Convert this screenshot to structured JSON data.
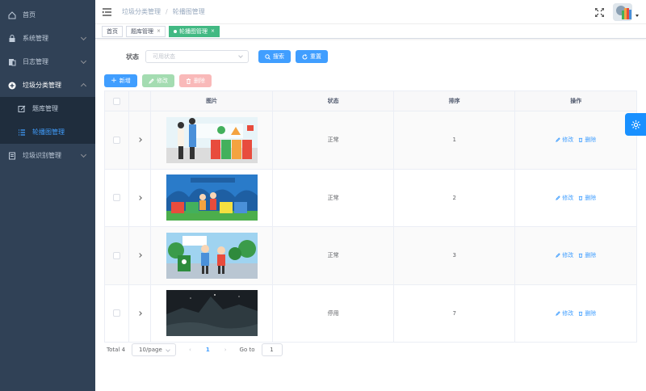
{
  "sidebar": {
    "items": [
      {
        "label": "首页",
        "icon": "home-icon"
      },
      {
        "label": "系统管理",
        "icon": "lock-icon"
      },
      {
        "label": "日志管理",
        "icon": "log-icon"
      },
      {
        "label": "垃圾分类管理",
        "icon": "plus-circle-icon"
      },
      {
        "label": "题库管理",
        "icon": "edit-icon"
      },
      {
        "label": "轮播图管理",
        "icon": "list-icon"
      },
      {
        "label": "垃圾识别管理",
        "icon": "doc-icon"
      }
    ]
  },
  "navbar": {
    "breadcrumb": [
      "垃圾分类管理",
      "轮播图管理"
    ]
  },
  "tags": [
    {
      "label": "首页"
    },
    {
      "label": "题库管理"
    },
    {
      "label": "轮播图管理"
    }
  ],
  "search": {
    "status_label": "状态",
    "status_placeholder": "可用状态",
    "search_btn": "搜索",
    "reset_btn": "重置"
  },
  "toolbar": {
    "add": "新增",
    "edit": "修改",
    "delete": "删除"
  },
  "table": {
    "headers": [
      "图片",
      "状态",
      "排序",
      "操作"
    ],
    "rows": [
      {
        "status": "正常",
        "order": "1",
        "edit": "修改",
        "delete": "删除"
      },
      {
        "status": "正常",
        "order": "2",
        "edit": "修改",
        "delete": "删除"
      },
      {
        "status": "正常",
        "order": "3",
        "edit": "修改",
        "delete": "删除"
      },
      {
        "status": "停用",
        "order": "7",
        "edit": "修改",
        "delete": "删除"
      }
    ]
  },
  "pagination": {
    "total": "Total 4",
    "page_size": "10/page",
    "current": "1",
    "goto_label": "Go to",
    "goto_value": "1"
  },
  "colors": {
    "sidebar_bg": "#304156",
    "primary": "#409eff",
    "active_tag": "#42b983"
  }
}
